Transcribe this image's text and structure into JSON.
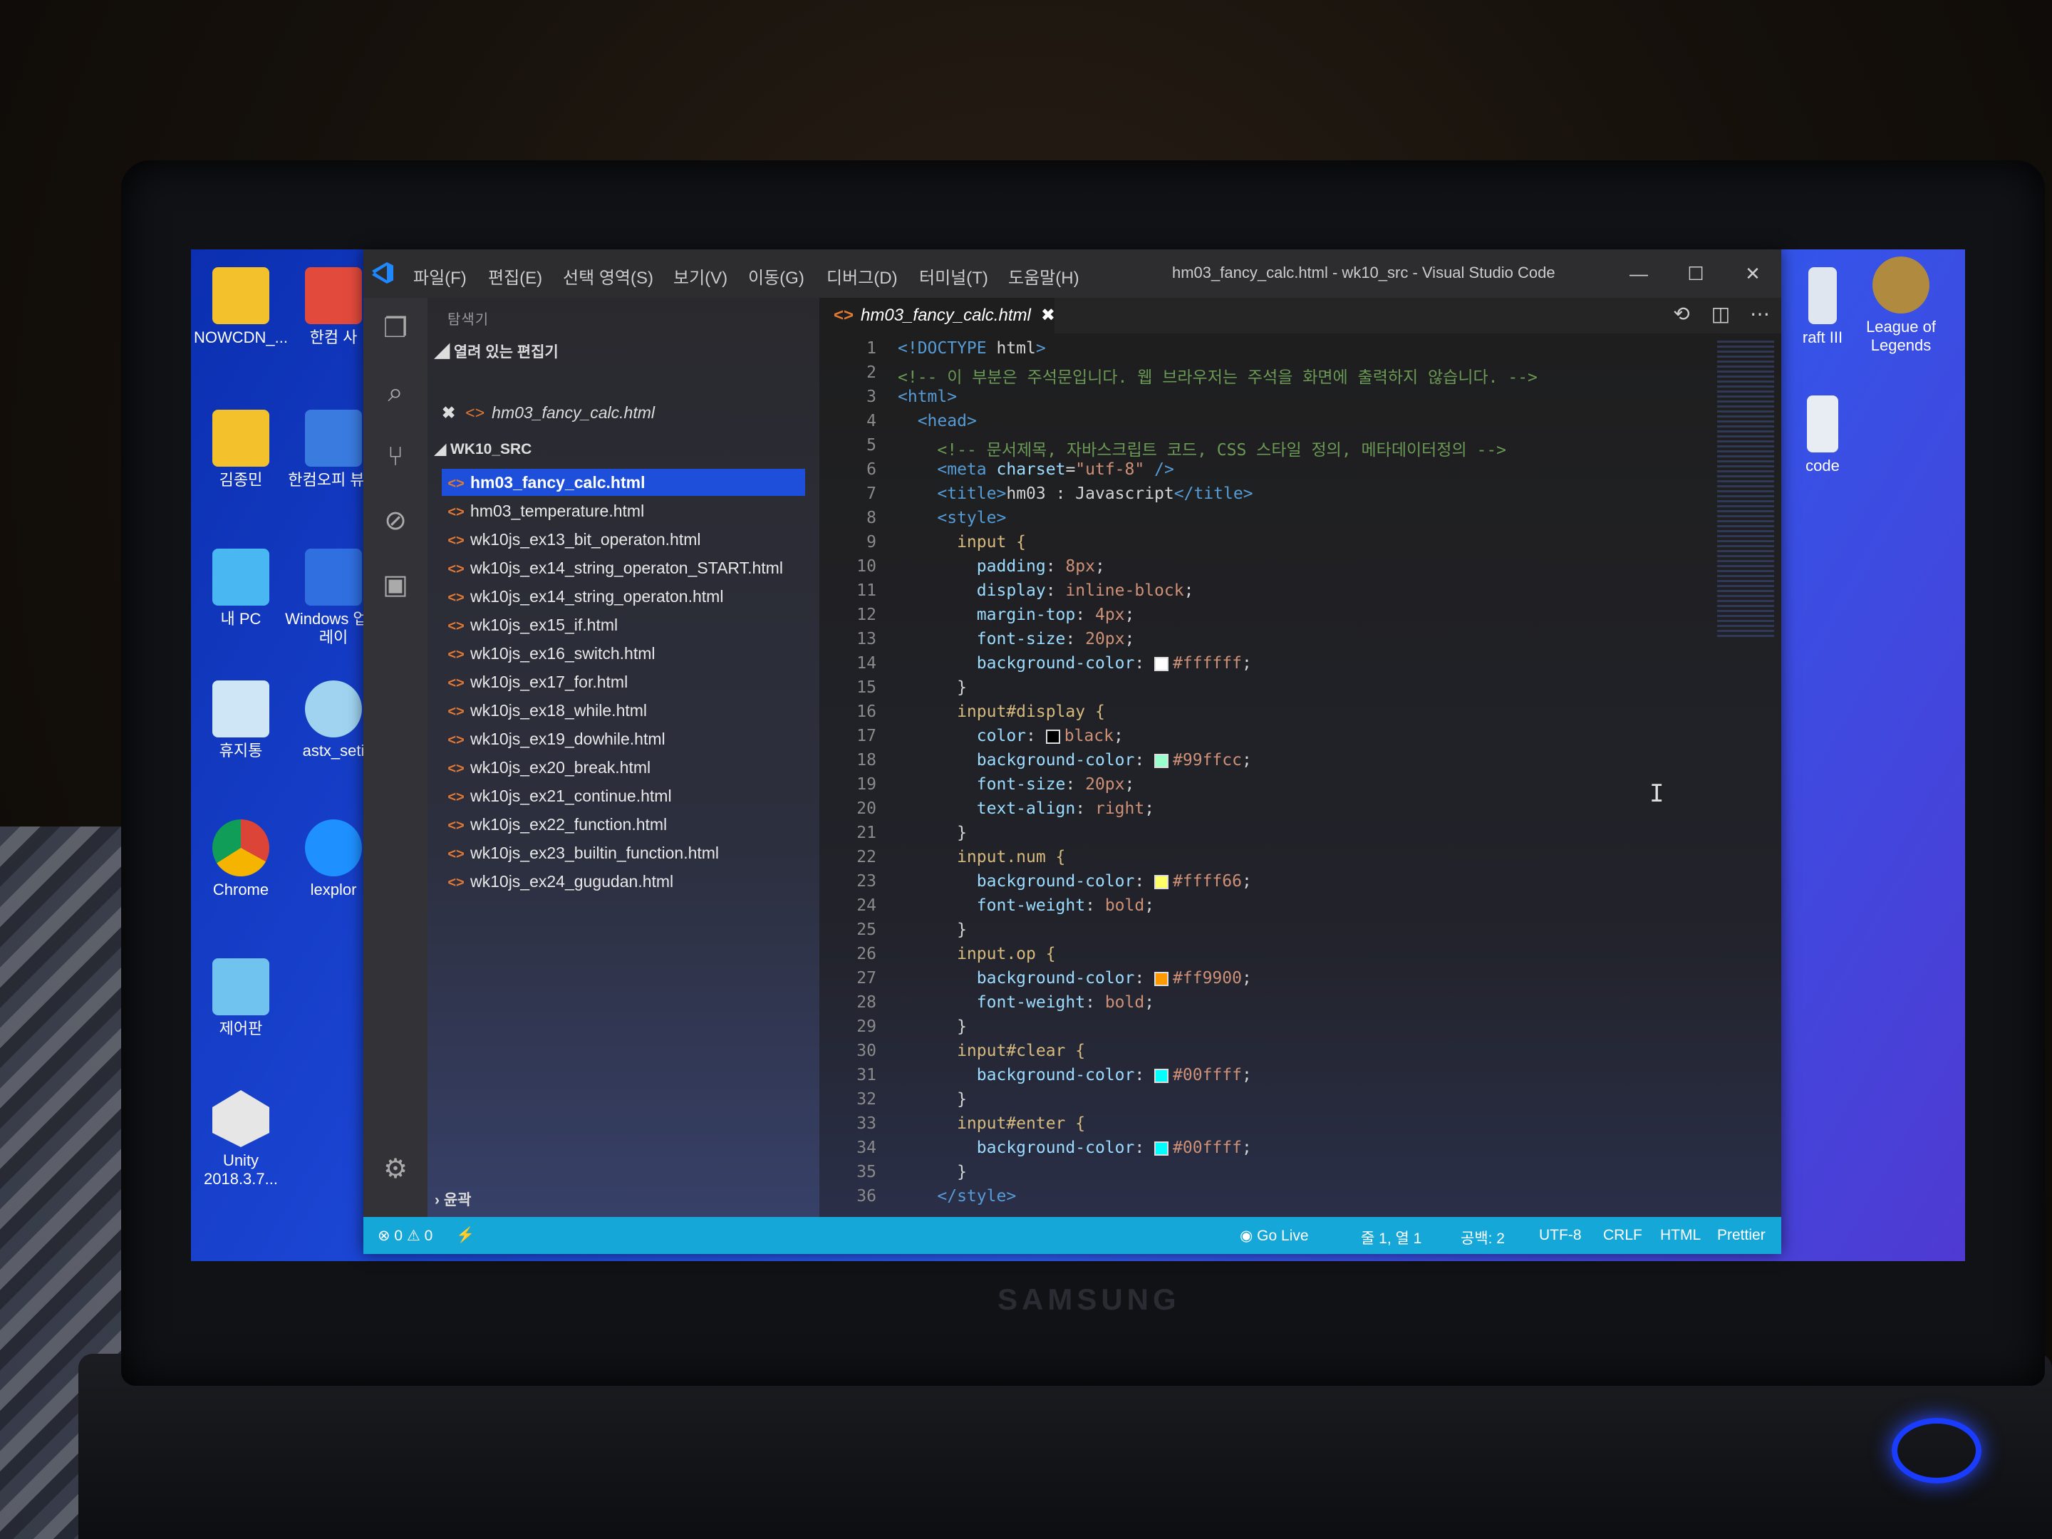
{
  "desktop": {
    "icons_left": [
      {
        "label": "NOWCDN_..."
      },
      {
        "label": "김종민"
      },
      {
        "label": "내 PC"
      },
      {
        "label": "휴지통"
      },
      {
        "label": "Chrome"
      },
      {
        "label": "제어판"
      },
      {
        "label": "Unity 2018.3.7..."
      }
    ],
    "icons_second": [
      {
        "label": "한컴 사"
      },
      {
        "label": "한컴오피 뷰어"
      },
      {
        "label": "Windows 업그레이"
      },
      {
        "label": "astx_seti"
      },
      {
        "label": "lexplor"
      }
    ],
    "icons_right": [
      {
        "label": "raft III"
      },
      {
        "label": "League of Legends"
      },
      {
        "label": "code"
      }
    ]
  },
  "window": {
    "title": "hm03_fancy_calc.html - wk10_src - Visual Studio Code",
    "menu": [
      "파일(F)",
      "편집(E)",
      "선택 영역(S)",
      "보기(V)",
      "이동(G)",
      "디버그(D)",
      "터미널(T)",
      "도움말(H)"
    ],
    "controls": {
      "minimize": "—",
      "maximize": "☐",
      "close": "✕"
    }
  },
  "sidebar": {
    "title": "탐색기",
    "open_editors_label": "열려 있는 편집기",
    "open_file": "hm03_fancy_calc.html",
    "folder_label": "WK10_SRC",
    "files": [
      "hm03_fancy_calc.html",
      "hm03_temperature.html",
      "wk10js_ex13_bit_operaton.html",
      "wk10js_ex14_string_operaton_START.html",
      "wk10js_ex14_string_operaton.html",
      "wk10js_ex15_if.html",
      "wk10js_ex16_switch.html",
      "wk10js_ex17_for.html",
      "wk10js_ex18_while.html",
      "wk10js_ex19_dowhile.html",
      "wk10js_ex20_break.html",
      "wk10js_ex21_continue.html",
      "wk10js_ex22_function.html",
      "wk10js_ex23_builtin_function.html",
      "wk10js_ex24_gugudan.html"
    ],
    "active_index": 0,
    "outline_label": "윤곽"
  },
  "editor": {
    "tab_label": "hm03_fancy_calc.html",
    "code_lines": [
      {
        "n": "1",
        "t": "<!DOCTYPE html>"
      },
      {
        "n": "2",
        "t": "<!-- 이 부분은 주석문입니다. 웹 브라우저는 주석을 화면에 출력하지 않습니다. -->"
      },
      {
        "n": "3",
        "t": "<html>"
      },
      {
        "n": "4",
        "t": "  <head>"
      },
      {
        "n": "5",
        "t": "    <!-- 문서제목, 자바스크립트 코드, CSS 스타일 정의, 메타데이터정의 -->"
      },
      {
        "n": "6",
        "t": "    <meta charset=\"utf-8\" />"
      },
      {
        "n": "7",
        "t": "    <title>hm03 : Javascript</title>"
      },
      {
        "n": "8",
        "t": "    <style>"
      },
      {
        "n": "9",
        "t": "      input {"
      },
      {
        "n": "10",
        "t": "        padding: 8px;"
      },
      {
        "n": "11",
        "t": "        display: inline-block;"
      },
      {
        "n": "12",
        "t": "        margin-top: 4px;"
      },
      {
        "n": "13",
        "t": "        font-size: 20px;"
      },
      {
        "n": "14",
        "t": "        background-color: #ffffff;"
      },
      {
        "n": "15",
        "t": "      }"
      },
      {
        "n": "16",
        "t": "      input#display {"
      },
      {
        "n": "17",
        "t": "        color: black;"
      },
      {
        "n": "18",
        "t": "        background-color: #99ffcc;"
      },
      {
        "n": "19",
        "t": "        font-size: 20px;"
      },
      {
        "n": "20",
        "t": "        text-align: right;"
      },
      {
        "n": "21",
        "t": "      }"
      },
      {
        "n": "22",
        "t": "      input.num {"
      },
      {
        "n": "23",
        "t": "        background-color: #ffff66;"
      },
      {
        "n": "24",
        "t": "        font-weight: bold;"
      },
      {
        "n": "25",
        "t": "      }"
      },
      {
        "n": "26",
        "t": "      input.op {"
      },
      {
        "n": "27",
        "t": "        background-color: #ff9900;"
      },
      {
        "n": "28",
        "t": "        font-weight: bold;"
      },
      {
        "n": "29",
        "t": "      }"
      },
      {
        "n": "30",
        "t": "      input#clear {"
      },
      {
        "n": "31",
        "t": "        background-color: #00ffff;"
      },
      {
        "n": "32",
        "t": "      }"
      },
      {
        "n": "33",
        "t": "      input#enter {"
      },
      {
        "n": "34",
        "t": "        background-color: #00ffff;"
      },
      {
        "n": "35",
        "t": "      }"
      },
      {
        "n": "36",
        "t": "    </style>"
      }
    ]
  },
  "statusbar": {
    "problems": "⊗ 0 ⚠ 0",
    "go_live": "Go Live",
    "position": "줄 1, 열 1",
    "spaces": "공백: 2",
    "encoding": "UTF-8",
    "eol": "CRLF",
    "language": "HTML",
    "formatter": "Prettier"
  },
  "brand": "SAMSUNG",
  "colors": {
    "accent": "#15a7d8",
    "selection": "#1e4fdb",
    "html_icon": "#e37933"
  }
}
